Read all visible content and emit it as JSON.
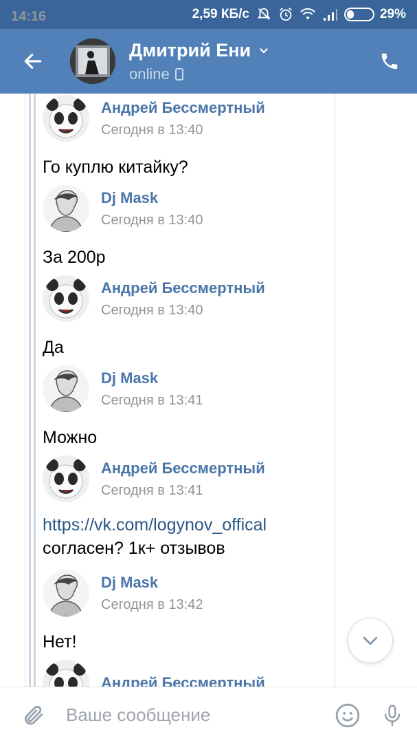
{
  "status_bar": {
    "time": "14:16",
    "speed": "2,59 КБ/с",
    "battery": "29%",
    "battery_level": 0.29
  },
  "header": {
    "title": "Дмитрий Ени",
    "status": "online",
    "colors": {
      "status_bar": "#39659a",
      "app_bar": "#5181b8"
    }
  },
  "messages": [
    {
      "sender": "Андрей Бессмертный",
      "time": "Сегодня в 13:40",
      "text": "Го куплю китайку?",
      "avatar": "panda-avatar"
    },
    {
      "sender": "Dj Mask",
      "time": "Сегодня в 13:40",
      "text": "За 200р",
      "avatar": "sketch-avatar"
    },
    {
      "sender": "Андрей Бессмертный",
      "time": "Сегодня в 13:40",
      "text": "Да",
      "avatar": "panda-avatar"
    },
    {
      "sender": "Dj Mask",
      "time": "Сегодня в 13:41",
      "text": "Можно",
      "avatar": "sketch-avatar"
    },
    {
      "sender": "Андрей Бессмертный",
      "time": "Сегодня в 13:41",
      "link": "https://vk.com/logynov_offical",
      "text": "согласен? 1к+ отзывов",
      "avatar": "panda-avatar"
    },
    {
      "sender": "Dj Mask",
      "time": "Сегодня в 13:42",
      "text": "Нет!",
      "avatar": "sketch-avatar"
    },
    {
      "sender": "Андрей Бессмертный",
      "avatar": "panda-avatar"
    }
  ],
  "input": {
    "placeholder": "Ваше сообщение"
  },
  "colors": {
    "link": "#2a5885",
    "sender": "#4a76a8",
    "meta": "#909499"
  }
}
